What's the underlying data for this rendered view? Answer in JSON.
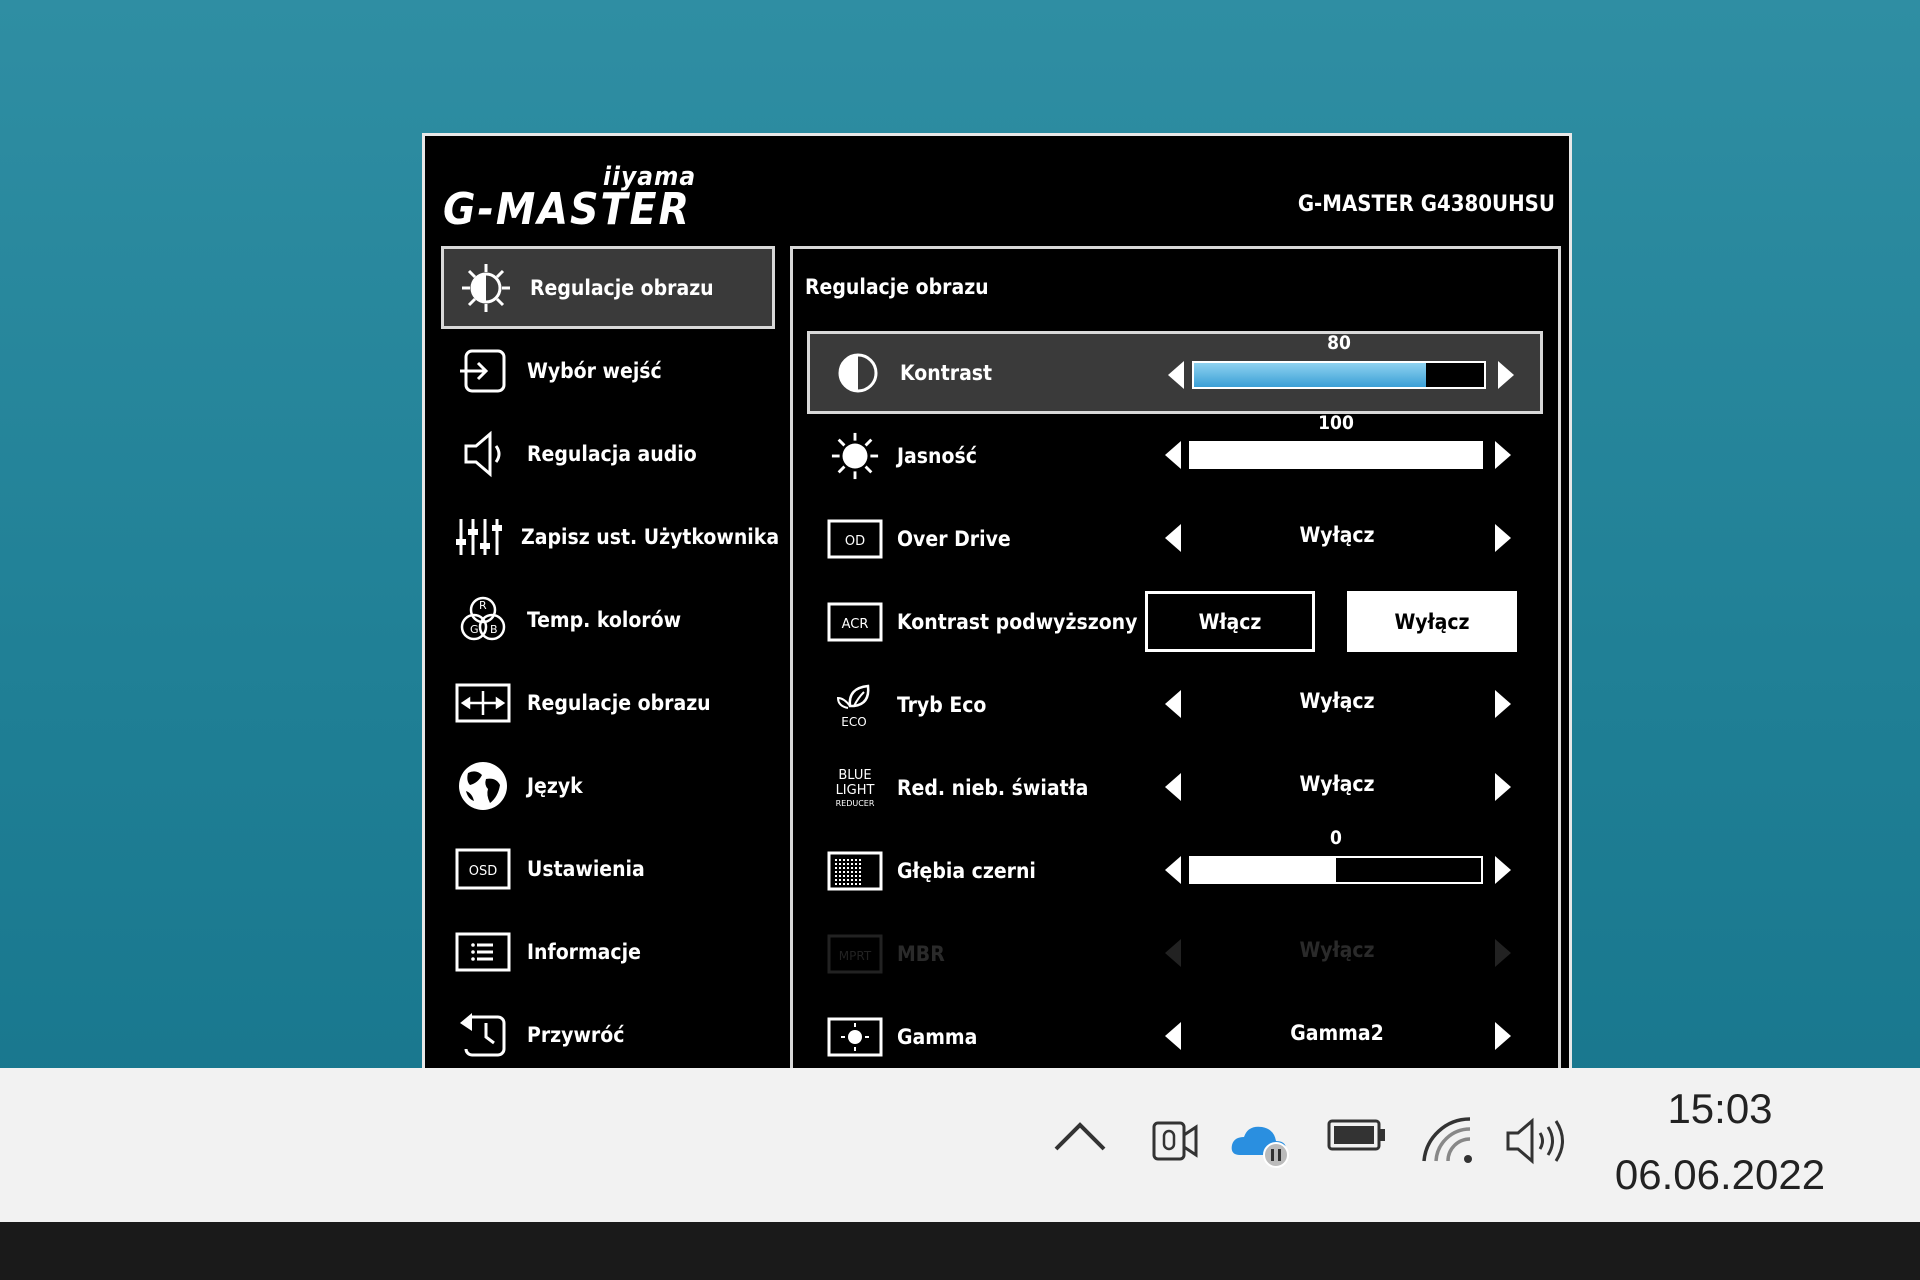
{
  "osd": {
    "brand": "iiyama",
    "logo": "G-MASTER",
    "model": "G-MASTER G4380UHSU",
    "menu": [
      {
        "label": "Regulacje obrazu",
        "icon": "brightness-contrast-icon",
        "selected": true
      },
      {
        "label": "Wybór wejść",
        "icon": "input-icon"
      },
      {
        "label": "Regulacja audio",
        "icon": "speaker-icon"
      },
      {
        "label": "Zapisz ust. Użytkownika",
        "icon": "sliders-icon"
      },
      {
        "label": "Temp. kolorów",
        "icon": "rgb-icon"
      },
      {
        "label": "Regulacje obrazu",
        "icon": "image-adjust-icon"
      },
      {
        "label": "Język",
        "icon": "globe-icon"
      },
      {
        "label": "Ustawienia",
        "icon": "osd-icon",
        "icon_text": "OSD"
      },
      {
        "label": "Informacje",
        "icon": "info-list-icon"
      },
      {
        "label": "Przywróć",
        "icon": "reset-clock-icon"
      }
    ],
    "panel": {
      "title": "Regulacje obrazu",
      "kontrast": {
        "label": "Kontrast",
        "value": "80",
        "level": 0.8
      },
      "jasnosc": {
        "label": "Jasność",
        "value": "100",
        "level": 1.0
      },
      "overdrive": {
        "label": "Over Drive",
        "icon_text": "OD",
        "value": "Wyłącz"
      },
      "acr": {
        "label": "Kontrast podwyższony",
        "icon_text": "ACR",
        "on_label": "Włącz",
        "off_label": "Wyłącz",
        "selected": "off"
      },
      "eco": {
        "label": "Tryb Eco",
        "icon_text": "ECO",
        "value": "Wyłącz"
      },
      "blue": {
        "label": "Red. nieb. światła",
        "icon_text_1": "BLUE",
        "icon_text_2": "LIGHT",
        "icon_text_3": "REDUCER",
        "value": "Wyłącz"
      },
      "black": {
        "label": "Głębia czerni",
        "value": "0",
        "level": 0.5
      },
      "mbr": {
        "label": "MBR",
        "icon_text": "MPRT",
        "value": "Wyłącz",
        "disabled": true
      },
      "gamma": {
        "label": "Gamma",
        "value": "Gamma2"
      }
    }
  },
  "taskbar": {
    "time": "15:03",
    "date": "06.06.2022",
    "icons": [
      "chevron-up-icon",
      "camera-mic-icon",
      "onedrive-paused-icon",
      "battery-icon",
      "wifi-icon",
      "volume-icon"
    ]
  }
}
